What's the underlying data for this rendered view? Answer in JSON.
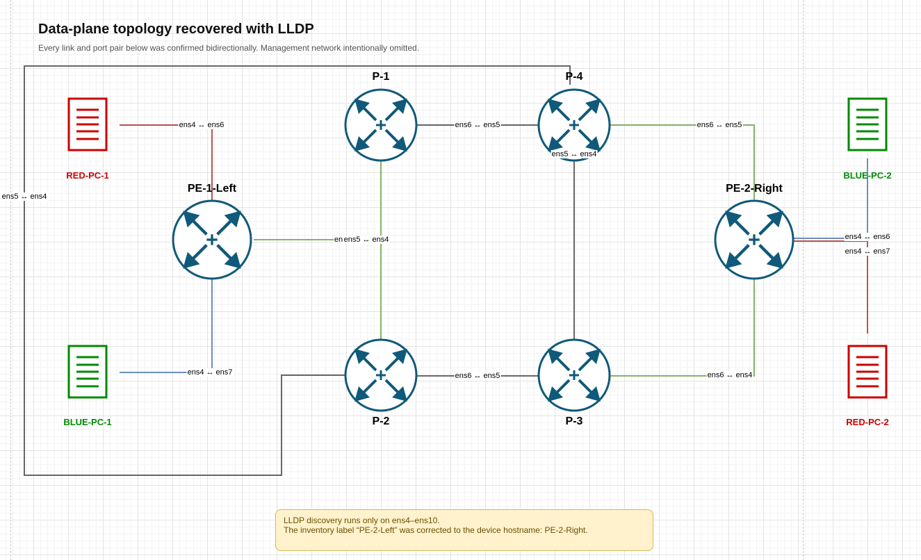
{
  "header": {
    "title": "Data-plane topology recovered with LLDP",
    "subtitle": "Every link and port pair below was confirmed bidirectionally. Management network intentionally omitted."
  },
  "colors": {
    "router": "#10597a",
    "red_pc": "#cc0000",
    "green_pc": "#008a00",
    "link_red": "#b85450",
    "link_blue": "#6c8ebf",
    "link_green": "#82b366",
    "link_gray": "#666666",
    "note_fill": "#fff2cc",
    "note_border": "#d6b656"
  },
  "nodes": {
    "p1": "P-1",
    "p2": "P-2",
    "p3": "P-3",
    "p4": "P-4",
    "pe1": "PE-1-Left",
    "pe2": "PE-2-Right",
    "red_pc_1": "RED-PC-1",
    "blue_pc_1": "BLUE-PC-1",
    "blue_pc_2": "BLUE-PC-2",
    "red_pc_2": "RED-PC-2"
  },
  "links": {
    "red_pc_1_pe1": "ens4 ↔ ens6",
    "blue_pc_1_pe1": "ens4 ↔ ens7",
    "pe1_p2_outer": "ens5 ↔ ens4",
    "pe1_p1": "ens5 ↔ ens4",
    "pe1_p1_overlap": "en",
    "p1_p4": "ens6 ↔ ens5",
    "p4_p3": "ens5 ↔ ens4",
    "p2_p3": "ens6 ↔ ens5",
    "p4_pe2": "ens6 ↔ ens5",
    "p3_pe2": "ens6 ↔ ens4",
    "pe2_blue_pc_2": "ens4 ↔ ens6",
    "pe2_red_pc_2": "ens4 ↔ ens7"
  },
  "note": {
    "line1": "LLDP discovery runs only on ens4–ens10.",
    "line2": "The inventory label “PE-2-Left” was corrected to the device hostname: PE-2-Right."
  }
}
